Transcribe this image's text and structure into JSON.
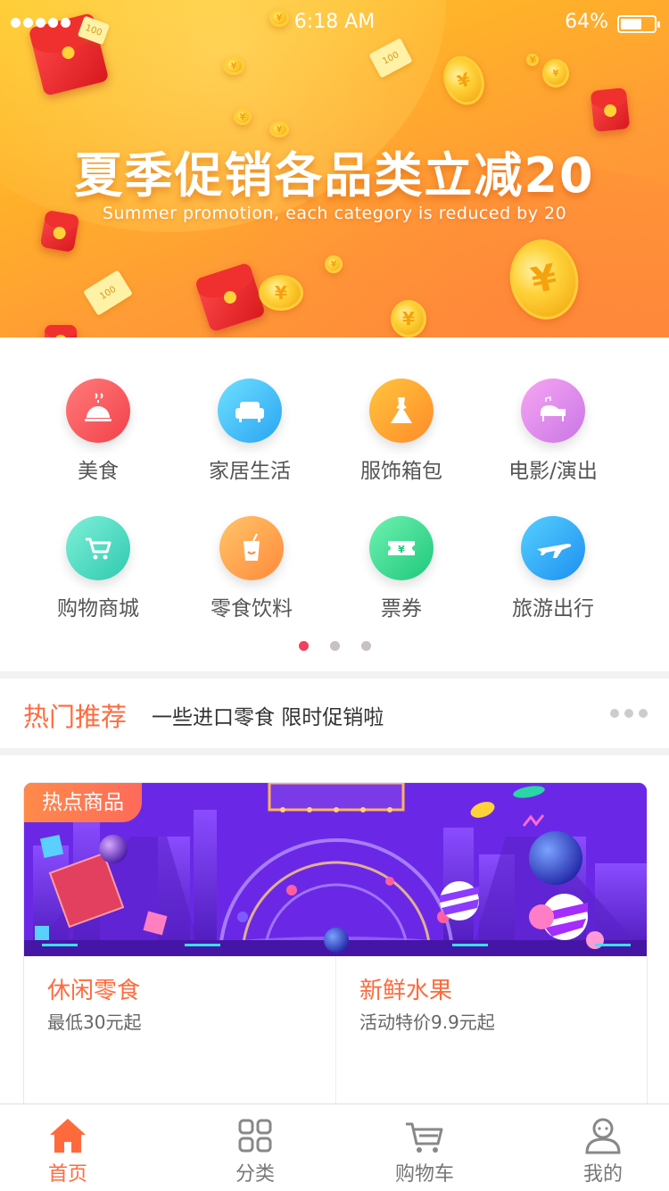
{
  "status_bar": {
    "time": "6:18 AM",
    "battery": "64%",
    "battery_level": 0.64
  },
  "banner": {
    "title": "夏季促销各品类立减20",
    "subtitle": "Summer promotion, each category is reduced by 20",
    "note_text": "100"
  },
  "categories": [
    {
      "label": "美食",
      "icon": "food-cloche-icon",
      "color": "#f2414a"
    },
    {
      "label": "家居生活",
      "icon": "sofa-icon",
      "color": "#2aa4f3"
    },
    {
      "label": "服饰箱包",
      "icon": "dress-icon",
      "color": "#ff8b2a"
    },
    {
      "label": "电影/演出",
      "icon": "piano-icon",
      "color": "#c976e6"
    },
    {
      "label": "购物商城",
      "icon": "shopping-cart-icon",
      "color": "#2fc9b0"
    },
    {
      "label": "零食饮料",
      "icon": "drink-cup-icon",
      "color": "#ff8a3b"
    },
    {
      "label": "票券",
      "icon": "ticket-icon",
      "color": "#1fc77c"
    },
    {
      "label": "旅游出行",
      "icon": "airplane-icon",
      "color": "#1e8ff0"
    }
  ],
  "pager": {
    "pages": 3,
    "current": 1
  },
  "hot": {
    "title": "热门推荐",
    "text": "一些进口零食 限时促销啦"
  },
  "featured": {
    "tag": "热点商品",
    "items": [
      {
        "name": "休闲零食",
        "price": "最低30元起"
      },
      {
        "name": "新鲜水果",
        "price": "活动特价9.9元起"
      }
    ]
  },
  "tabbar": [
    {
      "label": "首页",
      "icon": "home-icon",
      "active": true
    },
    {
      "label": "分类",
      "icon": "category-grid-icon",
      "active": false
    },
    {
      "label": "购物车",
      "icon": "cart-icon",
      "active": false
    },
    {
      "label": "我的",
      "icon": "user-icon",
      "active": false
    }
  ],
  "colors": {
    "accent": "#ff6a3d",
    "pager_active": "#f2415a"
  }
}
